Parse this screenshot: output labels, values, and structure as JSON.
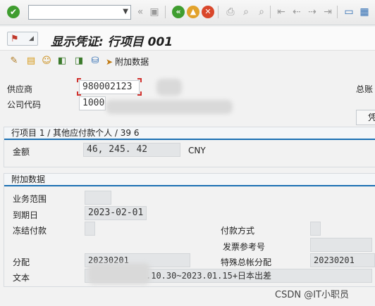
{
  "system_toolbar": {
    "command_field_value": "",
    "icons": [
      "check-icon",
      "double-chevron-icon",
      "save-icon",
      "back-icon",
      "exit-icon",
      "cancel-icon",
      "print-icon",
      "find-icon",
      "find-next-icon",
      "first-page-icon",
      "previous-page-icon",
      "next-page-icon",
      "last-page-icon",
      "create-session-icon",
      "shortcut-icon"
    ]
  },
  "title": {
    "text": "显示凭证: 行项目 001"
  },
  "app_toolbar": {
    "icons": [
      "glasses-icon",
      "document-icon",
      "people-icon",
      "arrow-left-icon",
      "arrow-right-icon",
      "stamp-icon"
    ],
    "extra_data_label": "附加数据"
  },
  "header": {
    "vendor_label": "供应商",
    "vendor_value": "980002123",
    "company_code_label": "公司代码",
    "company_code_value": "1000",
    "gl_account_label_partial": "总账",
    "right_button_label_partial": "凭"
  },
  "line_item": {
    "heading": "行项目 1 / 其他应付款个人 / 39 6",
    "amount_label": "金额",
    "amount_value": "46, 245. 42",
    "currency": "CNY"
  },
  "additional": {
    "heading": "附加数据",
    "business_area_label": "业务范围",
    "business_area_value": "",
    "due_date_label": "到期日",
    "due_date_value": "2023-02-01",
    "freeze_label": "冻结付款",
    "freeze_value": "",
    "payment_method_label": "付款方式",
    "payment_method_value": "",
    "invoice_ref_label": "发票参考号",
    "invoice_ref_value": "",
    "assignment_label": "分配",
    "assignment_value": "20230201",
    "special_gl_label": "特殊总帐分配",
    "special_gl_value": "20230201",
    "text_label": "文本",
    "text_value": ".10.30~2023.01.15+日本出差"
  },
  "watermark": "CSDN @IT小职员"
}
